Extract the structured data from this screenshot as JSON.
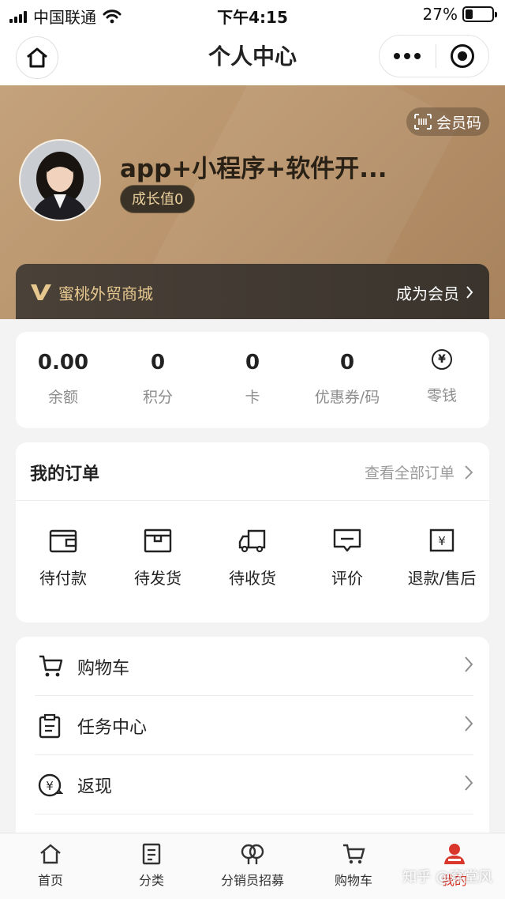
{
  "status_bar": {
    "carrier": "中国联通",
    "time": "下午4:15",
    "battery": "27%",
    "battery_level": 0.27
  },
  "nav": {
    "title": "个人中心"
  },
  "profile": {
    "member_code_label": "会员码",
    "username": "app+小程序+软件开...",
    "growth_label": "成长值0",
    "shop_name": "蜜桃外贸商城",
    "join_label": "成为会员"
  },
  "assets": [
    {
      "value": "0.00",
      "label": "余额"
    },
    {
      "value": "0",
      "label": "积分"
    },
    {
      "value": "0",
      "label": "卡"
    },
    {
      "value": "0",
      "label": "优惠券/码"
    },
    {
      "value": "",
      "label": "零钱",
      "icon": "yuan-coin-icon",
      "icon_glyph": "¥"
    }
  ],
  "orders": {
    "title": "我的订单",
    "view_all": "查看全部订单",
    "items": [
      {
        "label": "待付款",
        "icon": "wallet-icon"
      },
      {
        "label": "待发货",
        "icon": "package-icon"
      },
      {
        "label": "待收货",
        "icon": "truck-icon"
      },
      {
        "label": "评价",
        "icon": "comment-icon"
      },
      {
        "label": "退款/售后",
        "icon": "refund-icon",
        "icon_glyph": "¥"
      }
    ]
  },
  "menu": [
    {
      "label": "购物车",
      "icon": "cart-icon"
    },
    {
      "label": "任务中心",
      "icon": "clipboard-icon"
    },
    {
      "label": "返现",
      "icon": "cashback-icon",
      "icon_glyph": "¥"
    }
  ],
  "tabbar": [
    {
      "label": "首页",
      "icon": "home-icon"
    },
    {
      "label": "分类",
      "icon": "category-icon"
    },
    {
      "label": "分销员招募",
      "icon": "distributor-icon"
    },
    {
      "label": "购物车",
      "icon": "cart-icon"
    },
    {
      "label": "我的",
      "icon": "user-icon",
      "active": true
    }
  ],
  "watermark": "知乎 @穿堂风",
  "colors": {
    "accent": "#d9362c",
    "gold": "#e6c88f",
    "hero": "#b9946c"
  }
}
